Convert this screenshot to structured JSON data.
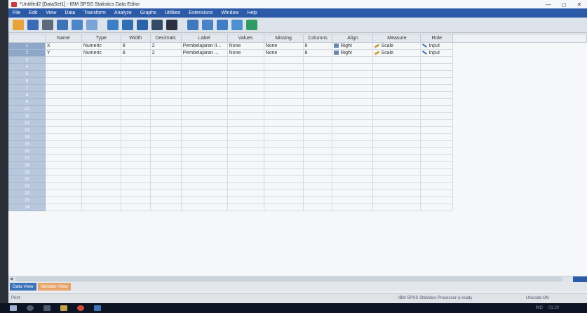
{
  "window": {
    "title": "*Untitled2 [DataSet1] - IBM SPSS Statistics Data Editor",
    "min": "—",
    "max": "◻",
    "close": "✕"
  },
  "menu": [
    "File",
    "Edit",
    "View",
    "Data",
    "Transform",
    "Analyze",
    "Graphs",
    "Utilities",
    "Extensions",
    "Window",
    "Help"
  ],
  "toolbar": {
    "buttons": [
      {
        "icon": "open-folder-icon",
        "color": "#e8a33a"
      },
      {
        "icon": "save-icon",
        "color": "#3a6bb5"
      },
      {
        "icon": "print-icon",
        "color": "#5c6a7a"
      },
      {
        "icon": "dialog-recall-icon",
        "color": "#3f73b8"
      },
      {
        "icon": "undo-icon",
        "color": "#4a86c8"
      },
      {
        "icon": "redo-icon",
        "color": "#7aa4d6"
      },
      {
        "icon": "go-to-case-icon",
        "color": "#3c7fc4"
      },
      {
        "icon": "go-to-variable-icon",
        "color": "#2f6fb2"
      },
      {
        "icon": "variables-icon",
        "color": "#2a64a8"
      },
      {
        "icon": "run-descriptives-icon",
        "color": "#334b66"
      },
      {
        "icon": "find-icon",
        "color": "#2b3140"
      },
      {
        "icon": "insert-cases-icon",
        "color": "#3e78bd"
      },
      {
        "icon": "insert-variable-icon",
        "color": "#4a84c6"
      },
      {
        "icon": "split-file-icon",
        "color": "#3f7ec2"
      },
      {
        "icon": "value-labels-icon",
        "color": "#4c92d2"
      },
      {
        "icon": "use-variable-sets-icon",
        "color": "#2f9d63"
      }
    ]
  },
  "columns": [
    "",
    "Name",
    "Type",
    "Width",
    "Decimals",
    "Label",
    "Values",
    "Missing",
    "Columns",
    "Align",
    "Measure",
    "Role"
  ],
  "variables": [
    {
      "num": "1",
      "name": "X",
      "type": "Numeric",
      "width": "8",
      "decimals": "2",
      "label": "Pembelajaran II...",
      "values": "None",
      "missing": "None",
      "columns": "8",
      "align": "Right",
      "measure": "Scale",
      "role": "Input"
    },
    {
      "num": "2",
      "name": "Y",
      "type": "Numeric",
      "width": "8",
      "decimals": "2",
      "label": "Pembelajaran ...",
      "values": "None",
      "missing": "None",
      "columns": "8",
      "align": "Right",
      "measure": "Scale",
      "role": "Input"
    }
  ],
  "empty_rows": [
    "3",
    "4",
    "5",
    "6",
    "7",
    "8",
    "9",
    "10",
    "11",
    "12",
    "13",
    "14",
    "15",
    "16",
    "17",
    "18",
    "19",
    "20",
    "21",
    "22",
    "23",
    "24"
  ],
  "tabs": {
    "data_view": "Data View",
    "variable_view": "Variable View"
  },
  "status": {
    "left": "Print",
    "processor": "IBM SPSS Statistics Processor is ready",
    "unicode": "Unicode:ON"
  },
  "taskbar": {
    "time": "01:20",
    "lang": "IND"
  },
  "colors": {
    "menubar": "#2b5aa8",
    "rownum": "#b8c7dc",
    "tab_active": "#e7a56b"
  }
}
